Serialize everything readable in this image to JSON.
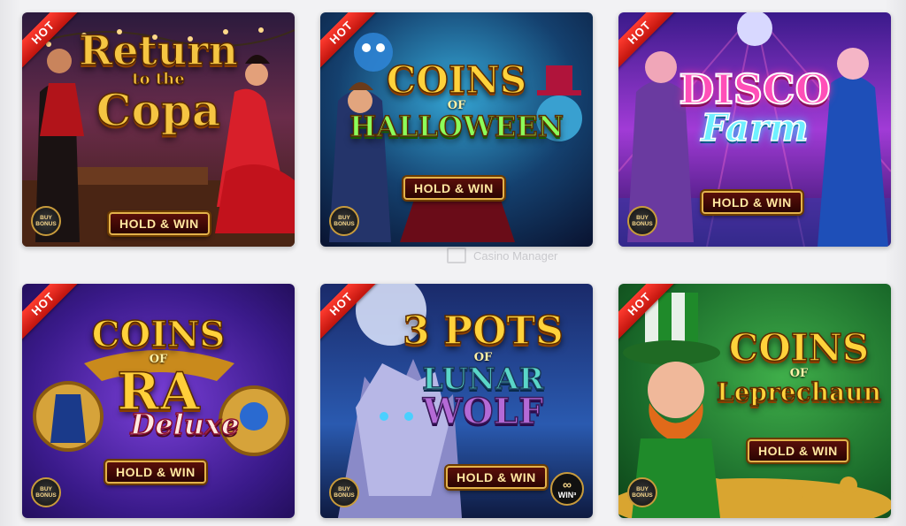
{
  "watermark": {
    "text": "Casino Manager"
  },
  "badges": {
    "hot": "HOT",
    "buy_line1": "BUY",
    "buy_line2": "BONUS",
    "hold_win": "HOLD & WIN",
    "win3": "WIN³"
  },
  "games": [
    {
      "title_main": "Return",
      "title_of": "to the",
      "title_sub": "Copa",
      "tm": "™"
    },
    {
      "title_main": "COINS",
      "title_of": "OF",
      "title_sub": "HALLOWEEN",
      "tm": "™"
    },
    {
      "title_main": "DISCO",
      "title_of": "",
      "title_sub": "Farm",
      "tm": "™"
    },
    {
      "title_main": "COINS",
      "title_of": "OF",
      "title_sub": "RA",
      "title_extra": "Deluxe",
      "tm": "™"
    },
    {
      "title_main": "3 POTS",
      "title_of": "OF",
      "title_sub": "LUNAR",
      "title_extra": "WOLF",
      "tm": "™"
    },
    {
      "title_main": "COINS",
      "title_of": "OF",
      "title_sub": "Leprechaun",
      "tm": "™"
    }
  ],
  "colors": {
    "hot_ribbon": "#e0231a",
    "hold_border": "#e3b24a",
    "page_bg": "#f2f2f4"
  }
}
